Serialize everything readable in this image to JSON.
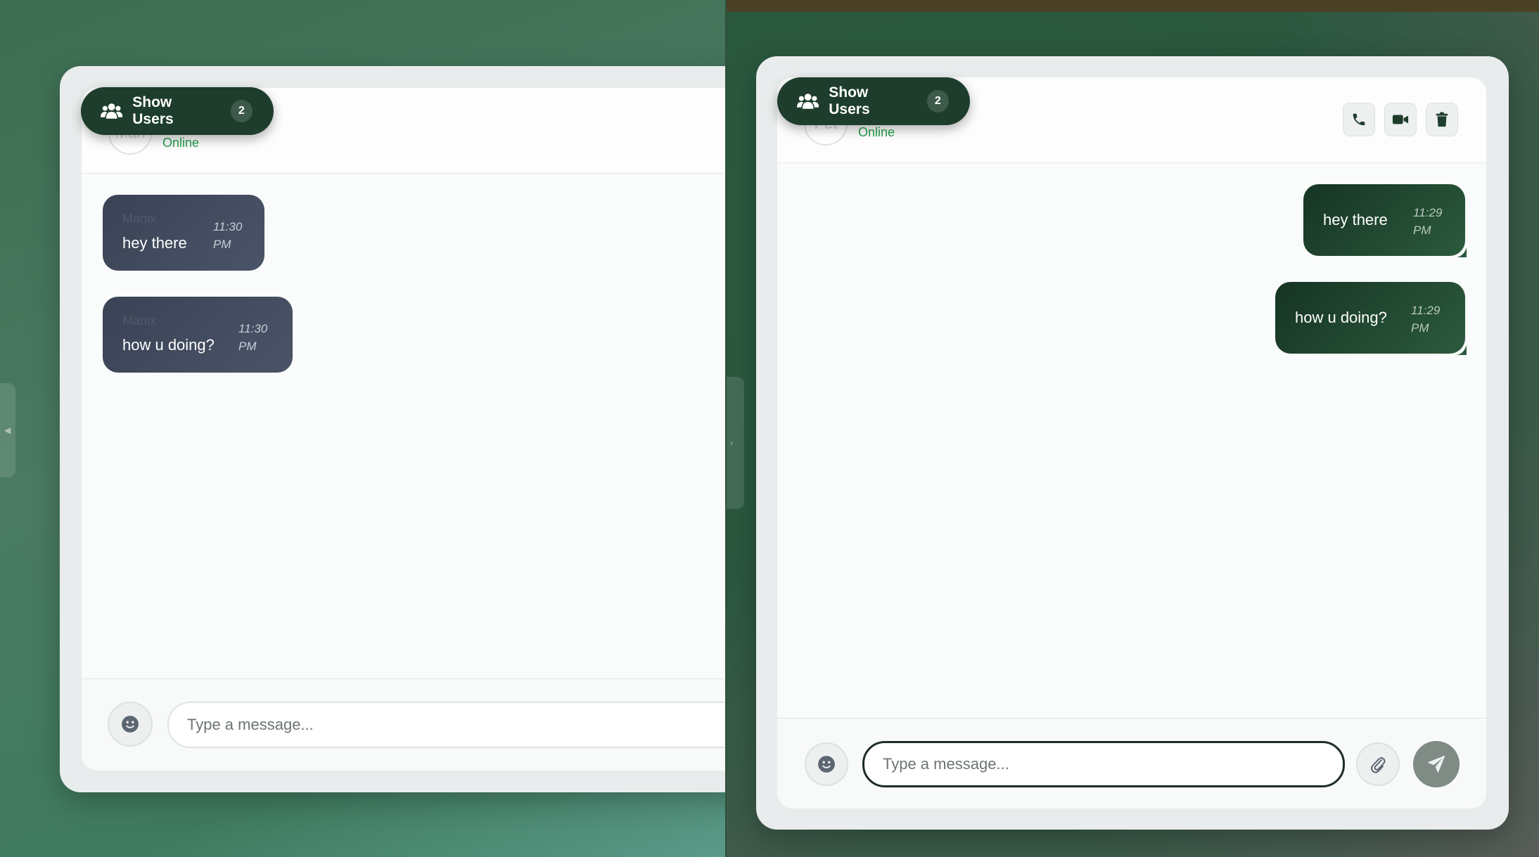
{
  "show_users": {
    "label": "Show Users",
    "count": "2"
  },
  "left_chat": {
    "contact_avatar_text": "Man",
    "status": "Online",
    "messages": [
      {
        "sender": "Manix",
        "text": "hey there",
        "time": "11:30 PM"
      },
      {
        "sender": "Manix",
        "text": "how u doing?",
        "time": "11:30 PM"
      }
    ],
    "input_placeholder": "Type a message..."
  },
  "right_chat": {
    "contact_avatar_text": "Pet",
    "status": "Online",
    "messages": [
      {
        "text": "hey there",
        "time": "11:29 PM"
      },
      {
        "text": "how u doing?",
        "time": "11:29 PM"
      }
    ],
    "input_placeholder": "Type a message...",
    "header_actions": [
      "phone-icon",
      "video-icon",
      "trash-icon"
    ]
  },
  "colors": {
    "accent_dark_green": "#1e3d2c",
    "online_green": "#22a04b",
    "incoming_bubble": "#3a4255",
    "outgoing_bubble": "#1f4a30"
  }
}
